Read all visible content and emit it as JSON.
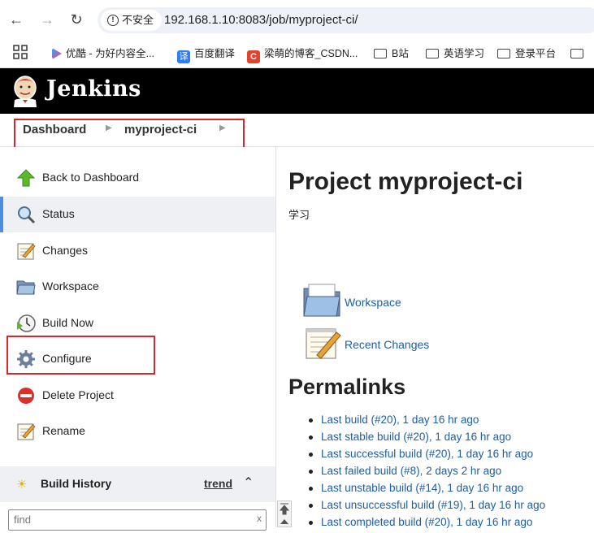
{
  "browser": {
    "back_icon": "arrow-left-icon",
    "forward_icon": "arrow-right-icon",
    "reload_icon": "reload-icon",
    "security_label": "不安全",
    "url": "192.168.1.10:8083/job/myproject-ci/"
  },
  "bookmarks": {
    "items": [
      {
        "label": "优酷 - 为好内容全..."
      },
      {
        "label": "百度翻译"
      },
      {
        "label": "梁萌的博客_CSDN..."
      },
      {
        "label": "B站"
      },
      {
        "label": "英语学习"
      },
      {
        "label": "登录平台"
      }
    ]
  },
  "header": {
    "title": "Jenkins"
  },
  "breadcrumb": {
    "items": [
      "Dashboard",
      "myproject-ci"
    ]
  },
  "sidebar": {
    "items": [
      {
        "label": "Back to Dashboard",
        "icon": "up-arrow-icon"
      },
      {
        "label": "Status",
        "icon": "magnifier-icon"
      },
      {
        "label": "Changes",
        "icon": "notepad-icon"
      },
      {
        "label": "Workspace",
        "icon": "folder-icon"
      },
      {
        "label": "Build Now",
        "icon": "clock-play-icon"
      },
      {
        "label": "Configure",
        "icon": "gear-icon"
      },
      {
        "label": "Delete Project",
        "icon": "no-entry-icon"
      },
      {
        "label": "Rename",
        "icon": "notepad-icon"
      }
    ],
    "active": "Status"
  },
  "build_history": {
    "title": "Build History",
    "trend_label": "trend",
    "find_placeholder": "find",
    "clear_label": "x"
  },
  "main": {
    "title": "Project myproject-ci",
    "description": "学习",
    "links": [
      {
        "label": "Workspace",
        "icon": "folder-icon"
      },
      {
        "label": "Recent Changes",
        "icon": "notepad-icon"
      }
    ],
    "permalinks_title": "Permalinks",
    "permalinks": [
      "Last build (#20), 1 day 16 hr ago",
      "Last stable build (#20), 1 day 16 hr ago",
      "Last successful build (#20), 1 day 16 hr ago",
      "Last failed build (#8), 2 days 2 hr ago",
      "Last unstable build (#14), 1 day 16 hr ago",
      "Last unsuccessful build (#19), 1 day 16 hr ago",
      "Last completed build (#20), 1 day 16 hr ago"
    ]
  },
  "colors": {
    "header_bg": "#000000",
    "link": "#1d5ea8",
    "annotation_red": "#d9262c",
    "active_bar": "#4b8ee0"
  }
}
